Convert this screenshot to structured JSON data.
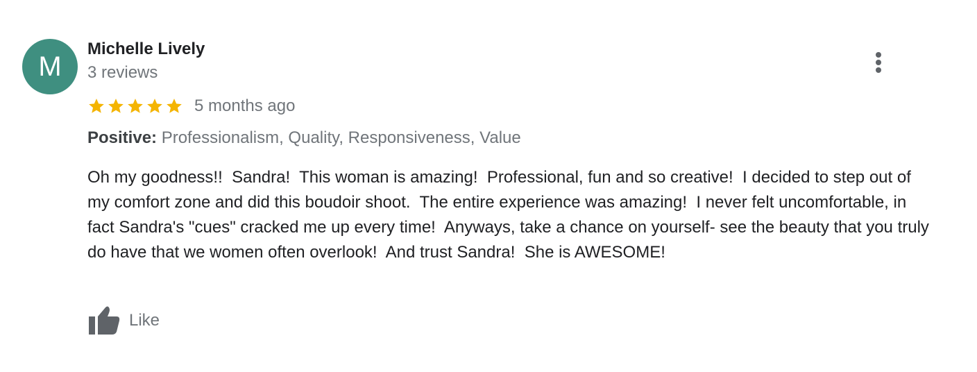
{
  "review": {
    "avatar_letter": "M",
    "reviewer_name": "Michelle Lively",
    "review_count": "3 reviews",
    "rating": 5,
    "rating_max": 5,
    "date": "5 months ago",
    "attributes_label": "Positive:",
    "attributes_value": "Professionalism, Quality, Responsiveness, Value",
    "text": "Oh my goodness!!  Sandra!  This woman is amazing!  Professional, fun and so creative!  I decided to step out of my comfort zone and did this boudoir shoot.  The entire experience was amazing!  I never felt uncomfortable, in fact Sandra's \"cues\" cracked me up every time!  Anyways, take a chance on yourself- see the beauty that you truly do have that we women often overlook!  And trust Sandra!  She is AWESOME!",
    "like_label": "Like"
  },
  "colors": {
    "avatar_bg": "#3f8f80",
    "star": "#f4b400",
    "secondary_text": "#70757a",
    "primary_text": "#202124",
    "icon": "#5f6368"
  },
  "icons": {
    "more": "more-vert-icon",
    "star": "star-icon",
    "like": "thumb-up-icon"
  }
}
